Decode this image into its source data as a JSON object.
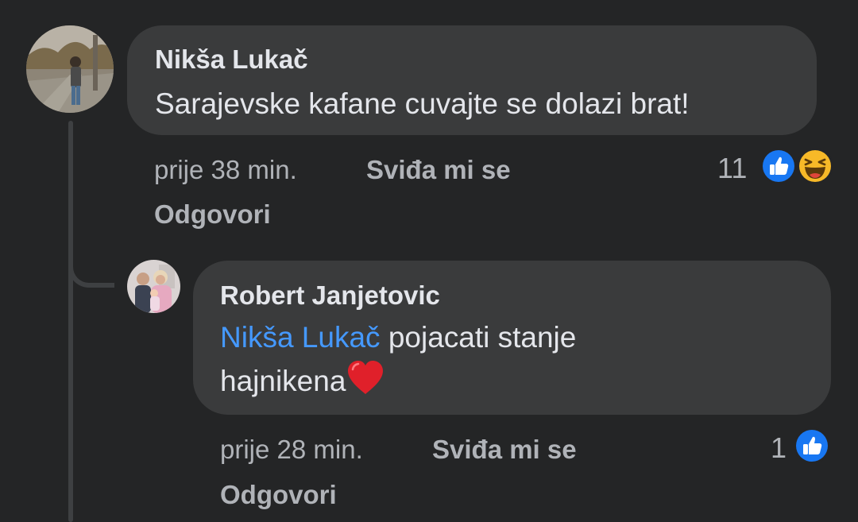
{
  "comment": {
    "author": "Nikša Lukač",
    "text": "Sarajevske kafane cuvajte se dolazi brat!",
    "time": "prije 38 min.",
    "like_label": "Sviđa mi se",
    "reply_label": "Odgovori",
    "reaction_count": "11",
    "reactions": [
      "like-icon",
      "haha-icon"
    ],
    "colors": {
      "like": "#1877f2",
      "haha": "#f7b928"
    }
  },
  "reply": {
    "author": "Robert Janjetovic",
    "mention": "Nikša Lukač",
    "text_line1": "pojacati stanje",
    "text_line2": "hajnikena",
    "emoji": "heart-icon",
    "time": "prije 28 min.",
    "like_label": "Sviđa mi se",
    "reply_label": "Odgovori",
    "reaction_count": "1",
    "reactions": [
      "like-icon"
    ],
    "colors": {
      "mention": "#4599ff",
      "heart": "#e0202a"
    }
  }
}
